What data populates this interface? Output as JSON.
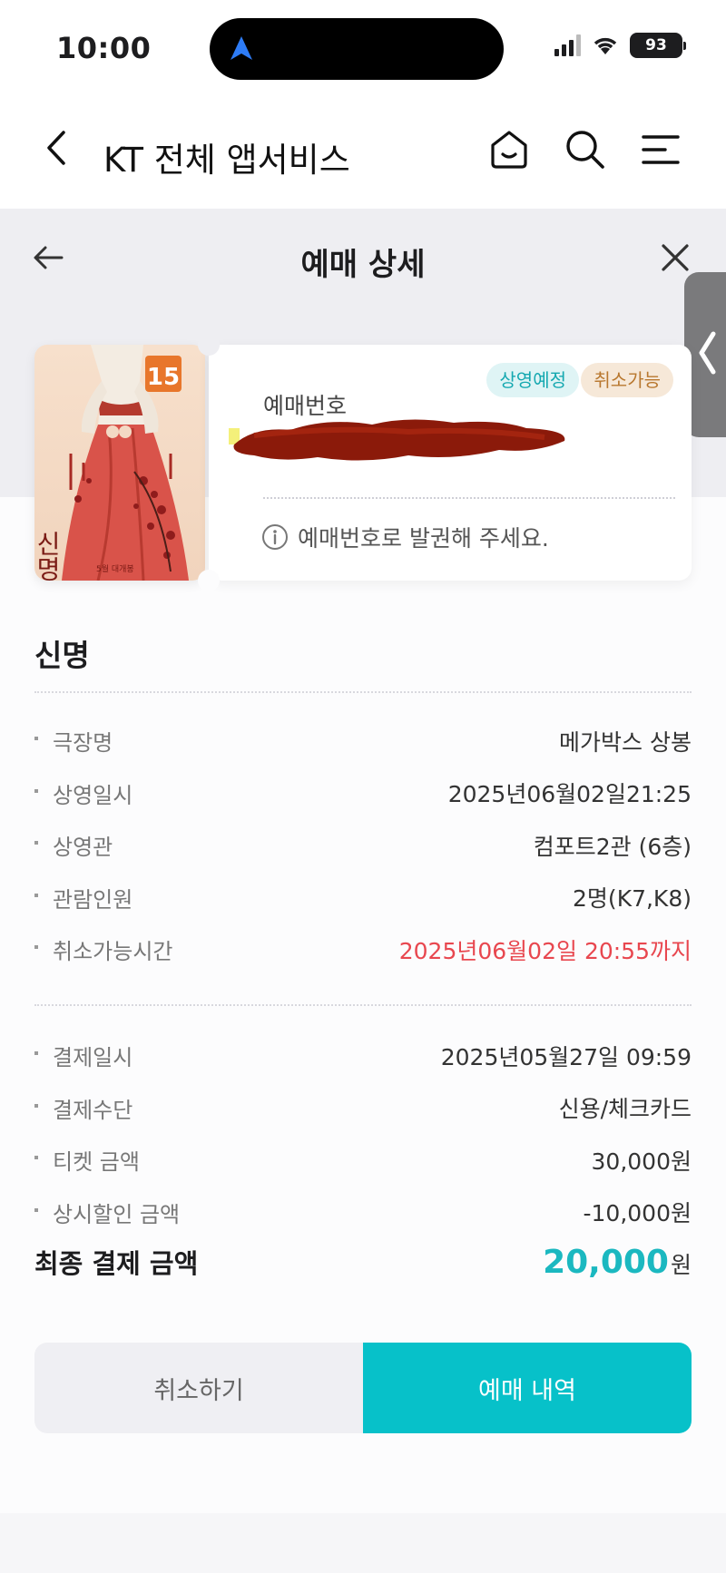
{
  "status_bar": {
    "time": "10:00",
    "battery": "93"
  },
  "app_header": {
    "title": "KT 전체 앱서비스"
  },
  "sheet": {
    "title": "예매 상세"
  },
  "ticket": {
    "age_rating": "15",
    "poster_title": "신명",
    "poster_caption": "5월 대개봉",
    "badges": [
      "상영예정",
      "취소가능"
    ],
    "reservation_label": "예매번호",
    "notice": "예매번호로 발권해 주세요."
  },
  "movie": {
    "title": "신명",
    "details": [
      {
        "label": "극장명",
        "value": "메가박스 상봉"
      },
      {
        "label": "상영일시",
        "value": "2025년06월02일21:25"
      },
      {
        "label": "상영관",
        "value": "컴포트2관 (6층)"
      },
      {
        "label": "관람인원",
        "value": "2명(K7,K8)"
      },
      {
        "label": "취소가능시간",
        "value": "2025년06월02일 20:55까지"
      }
    ],
    "payment": [
      {
        "label": "결제일시",
        "value": "2025년05월27일 09:59"
      },
      {
        "label": "결제수단",
        "value": "신용/체크카드"
      },
      {
        "label": "티켓 금액",
        "value": "30,000원"
      },
      {
        "label": "상시할인 금액",
        "value": "-10,000원"
      }
    ],
    "final_label": "최종 결제 금액",
    "final_amount": "20,000",
    "final_unit": "원"
  },
  "buttons": {
    "cancel": "취소하기",
    "history": "예매 내역"
  },
  "colors": {
    "accent": "#07c1c9",
    "warning": "#e8474f",
    "sheet_bg": "#eeeef2"
  }
}
